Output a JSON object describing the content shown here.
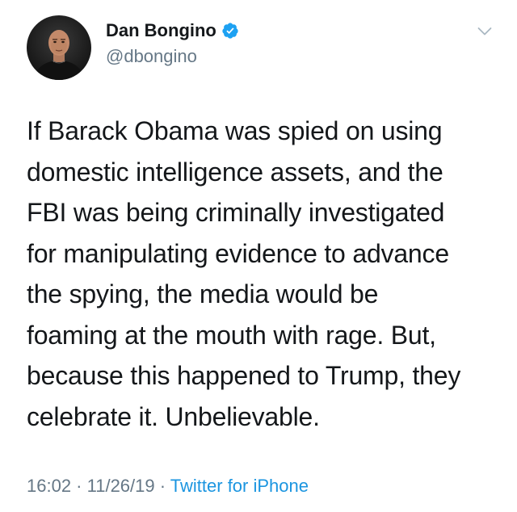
{
  "author": {
    "display_name": "Dan Bongino",
    "handle": "@dbongino",
    "verified": true
  },
  "tweet": {
    "text": "If Barack Obama was spied on using\ndomestic intelligence assets, and the\nFBI was being criminally investigated\nfor manipulating evidence to advance\nthe spying, the media would be\nfoaming at the mouth with rage. But,\nbecause this happened to Trump, they\ncelebrate it. Unbelievable."
  },
  "meta": {
    "time": "16:02",
    "date": "11/26/19",
    "separator": " · ",
    "source": "Twitter for iPhone"
  },
  "icons": {
    "verified": "verified-badge-icon",
    "menu": "chevron-down-icon"
  },
  "colors": {
    "verified_blue": "#1da1f2",
    "link_blue": "#1b95e0",
    "secondary_gray": "#657786",
    "text": "#14171a"
  }
}
